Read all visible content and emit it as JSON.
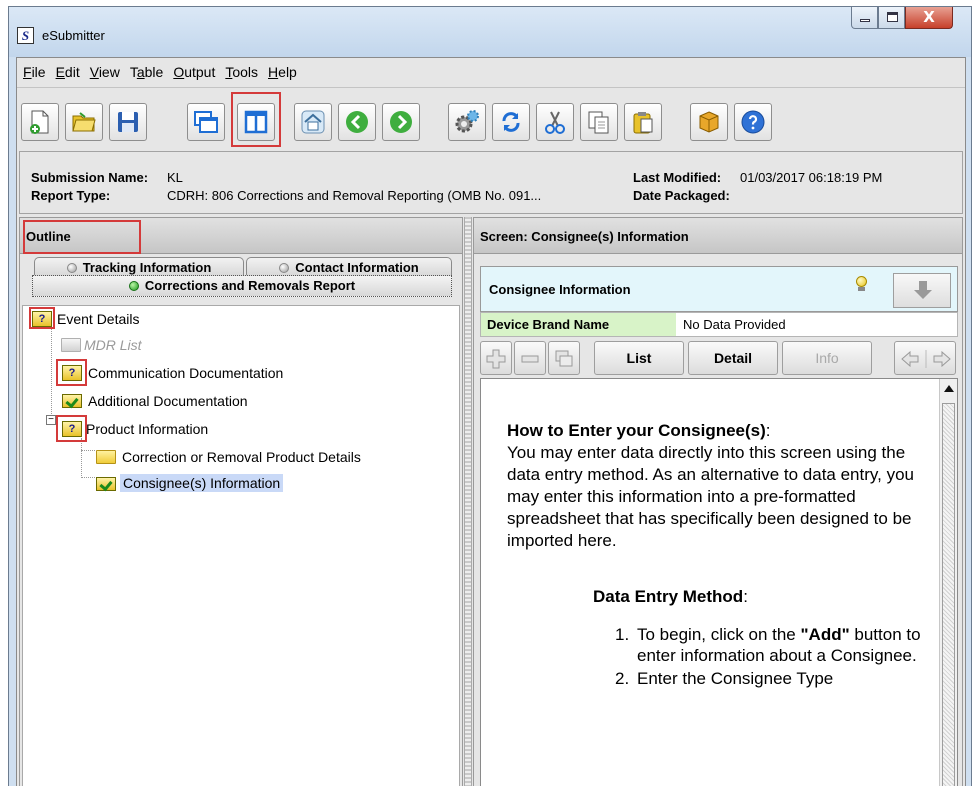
{
  "window": {
    "title": "eSubmitter",
    "app_icon_letter": "S",
    "close_glyph": "X"
  },
  "menu": [
    {
      "mnemonic": "F",
      "rest": "ile"
    },
    {
      "mnemonic": "E",
      "rest": "dit"
    },
    {
      "mnemonic": "V",
      "rest": "iew"
    },
    {
      "pre": "T",
      "mnemonic": "a",
      "rest": "ble"
    },
    {
      "mnemonic": "O",
      "rest": "utput"
    },
    {
      "mnemonic": "T",
      "rest": "ools"
    },
    {
      "mnemonic": "H",
      "rest": "elp"
    }
  ],
  "toolbar": {
    "buttons": [
      "new-document",
      "open-folder",
      "save",
      "windows",
      "split-view",
      "home",
      "back",
      "forward",
      "settings",
      "refresh",
      "cut",
      "copy",
      "paste",
      "package",
      "help"
    ]
  },
  "info": {
    "submission_name_label": "Submission Name:",
    "submission_name_value": "KL",
    "report_type_label": "Report Type:",
    "report_type_value": "CDRH: 806 Corrections and Removal Reporting (OMB No. 091...",
    "last_modified_label": "Last Modified:",
    "last_modified_value": "01/03/2017 06:18:19 PM",
    "date_packaged_label": "Date Packaged:"
  },
  "outline": {
    "title": "Outline",
    "tabs": [
      "Tracking Information",
      "Contact Information"
    ],
    "active_tab": "Corrections and Removals Report",
    "tree": {
      "event_details": "Event Details",
      "mdr_list": "MDR List",
      "communication_documentation": "Communication Documentation",
      "additional_documentation": "Additional Documentation",
      "product_information": "Product Information",
      "correction_or_removal_product_details": "Correction or Removal Product Details",
      "consignees_information": "Consignee(s) Information",
      "question_glyph": "?",
      "expander_glyph": "−"
    }
  },
  "screen": {
    "title": "Screen: Consignee(s) Information",
    "section_title": "Consignee Information",
    "field_label": "Device Brand Name",
    "field_value": "No Data Provided",
    "buttons": {
      "list": "List",
      "detail": "Detail",
      "info": "Info"
    },
    "help": {
      "heading_bold": "How to Enter your Consignee(s)",
      "heading_rest": ":",
      "paragraph": "You may enter data directly into this screen using the data entry method. As an alternative to data entry, you may enter this information into a pre-formatted spreadsheet that has specifically been designed to be imported here.",
      "subheading_bold": "Data Entry Method",
      "subheading_rest": ":",
      "steps": [
        {
          "num": "1.",
          "before": "To begin, click on the ",
          "bold": "\"Add\"",
          "after": " button to enter information about a Consignee."
        },
        {
          "num": "2.",
          "before": "Enter the Consignee Type",
          "bold": "",
          "after": ""
        }
      ]
    }
  },
  "colors": {
    "highlight_red": "#d43a3a",
    "selected_node": "#c9d9f7",
    "consignee_header": "#e3f6fb",
    "field_label_bg": "#d8f3c8"
  }
}
